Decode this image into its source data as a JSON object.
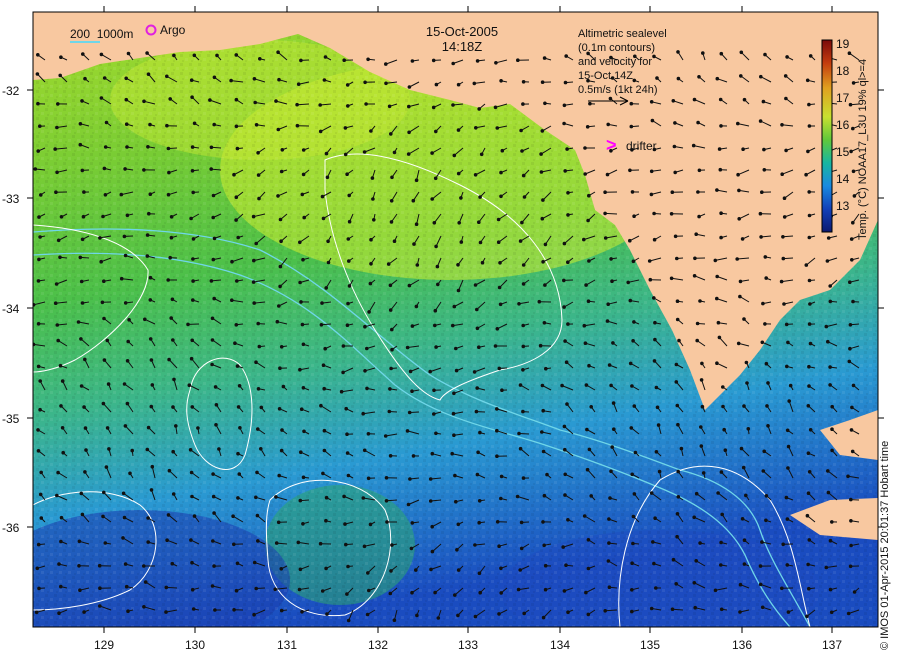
{
  "title": {
    "date": "15-Oct-2005",
    "time": "14:18Z"
  },
  "info": {
    "lines": [
      "Altimetric sealevel",
      "(0.1m contours)",
      "and velocity for",
      "15-Oct 14Z",
      "0.5m/s (1kt 24h)"
    ]
  },
  "legend": {
    "isobath_label": "200  1000m",
    "argo_label": "Argo",
    "drifter_label": "drifter",
    "drifter_symbol": ">"
  },
  "colorbar": {
    "label": "Temp. (°C) NOAA17_L3U 19% ql>=4",
    "ticks": [
      "19",
      "18",
      "17",
      "16",
      "15",
      "14",
      "13"
    ],
    "colors": [
      "#7a0a0a",
      "#c43c0e",
      "#e0a020",
      "#c8e030",
      "#60c83a",
      "#18b6a0",
      "#1a8ae0",
      "#1240b8",
      "#0c1a70"
    ]
  },
  "axes": {
    "x_ticks": [
      "129",
      "130",
      "131",
      "132",
      "133",
      "134",
      "135",
      "136",
      "137"
    ],
    "y_ticks": [
      "-32",
      "-33",
      "-34",
      "-35",
      "-36"
    ]
  },
  "credit": "© IMOS 01-Apr-2015 20:01:37 Hobart time",
  "colors": {
    "land": "#f8c8a0",
    "contour": "#ffffff",
    "isobath": "#6fd6e8",
    "argo": "#e020e0",
    "drifter": "#ff00ff"
  }
}
